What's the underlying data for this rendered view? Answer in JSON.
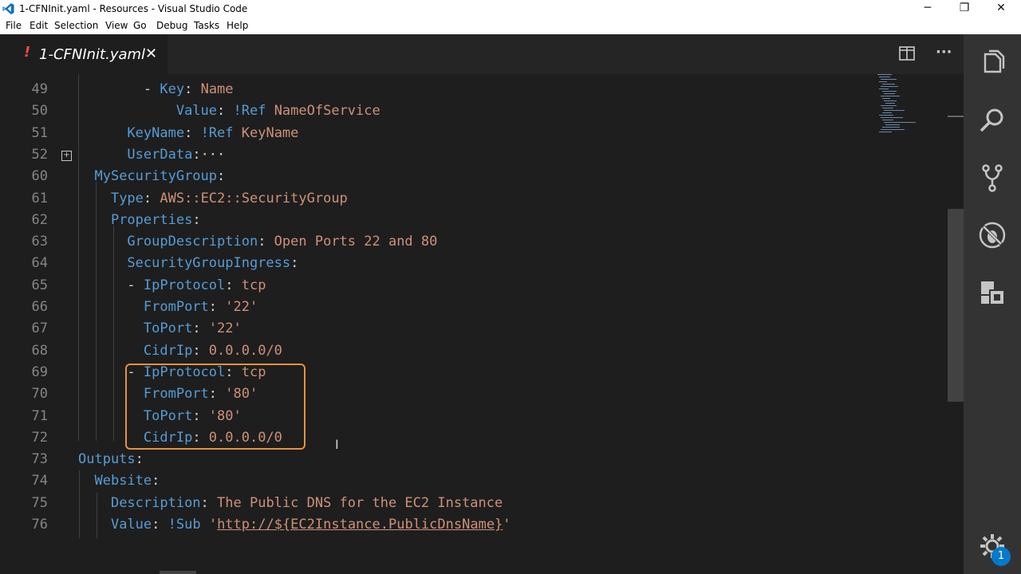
{
  "window": {
    "title": "1-CFNInit.yaml - Resources - Visual Studio Code",
    "controls": {
      "minimize": "─",
      "maximize": "❐",
      "close": "✕"
    }
  },
  "menu": [
    "File",
    "Edit",
    "Selection",
    "View",
    "Go",
    "Debug",
    "Tasks",
    "Help"
  ],
  "tab": {
    "modified_marker": "!",
    "name": "1-CFNInit.yaml",
    "close": "✕"
  },
  "editor_actions": {
    "more": "···"
  },
  "lines": [
    {
      "num": "49",
      "indent": "    ",
      "segs": [
        {
          "t": "- ",
          "c": "p"
        },
        {
          "t": "Key",
          "c": "k"
        },
        {
          "t": ": ",
          "c": "p"
        },
        {
          "t": "Name",
          "c": "s"
        }
      ]
    },
    {
      "num": "50",
      "indent": "      ",
      "segs": [
        {
          "t": "Value",
          "c": "k"
        },
        {
          "t": ": ",
          "c": "p"
        },
        {
          "t": "!Ref ",
          "c": "k"
        },
        {
          "t": "NameOfService",
          "c": "s"
        }
      ]
    },
    {
      "num": "51",
      "indent": "   ",
      "segs": [
        {
          "t": "KeyName",
          "c": "k"
        },
        {
          "t": ": ",
          "c": "p"
        },
        {
          "t": "!Ref ",
          "c": "k"
        },
        {
          "t": "KeyName",
          "c": "s"
        }
      ]
    },
    {
      "num": "52",
      "indent": "   ",
      "segs": [
        {
          "t": "UserData",
          "c": "k"
        },
        {
          "t": ":",
          "c": "p"
        },
        {
          "t": "···",
          "c": "p"
        }
      ]
    },
    {
      "num": "60",
      "indent": " ",
      "segs": [
        {
          "t": "MySecurityGroup",
          "c": "k"
        },
        {
          "t": ":",
          "c": "p"
        }
      ]
    },
    {
      "num": "61",
      "indent": "  ",
      "segs": [
        {
          "t": "Type",
          "c": "k"
        },
        {
          "t": ": ",
          "c": "p"
        },
        {
          "t": "AWS::EC2::SecurityGroup",
          "c": "s"
        }
      ]
    },
    {
      "num": "62",
      "indent": "  ",
      "segs": [
        {
          "t": "Properties",
          "c": "k"
        },
        {
          "t": ":",
          "c": "p"
        }
      ]
    },
    {
      "num": "63",
      "indent": "   ",
      "segs": [
        {
          "t": "GroupDescription",
          "c": "k"
        },
        {
          "t": ": ",
          "c": "p"
        },
        {
          "t": "Open Ports 22 and 80",
          "c": "s"
        }
      ]
    },
    {
      "num": "64",
      "indent": "   ",
      "segs": [
        {
          "t": "SecurityGroupIngress",
          "c": "k"
        },
        {
          "t": ":",
          "c": "p"
        }
      ]
    },
    {
      "num": "65",
      "indent": "   ",
      "segs": [
        {
          "t": "- ",
          "c": "p"
        },
        {
          "t": "IpProtocol",
          "c": "k"
        },
        {
          "t": ": ",
          "c": "p"
        },
        {
          "t": "tcp",
          "c": "s"
        }
      ]
    },
    {
      "num": "66",
      "indent": "    ",
      "segs": [
        {
          "t": "FromPort",
          "c": "k"
        },
        {
          "t": ": ",
          "c": "p"
        },
        {
          "t": "'22'",
          "c": "s"
        }
      ]
    },
    {
      "num": "67",
      "indent": "    ",
      "segs": [
        {
          "t": "ToPort",
          "c": "k"
        },
        {
          "t": ": ",
          "c": "p"
        },
        {
          "t": "'22'",
          "c": "s"
        }
      ]
    },
    {
      "num": "68",
      "indent": "    ",
      "segs": [
        {
          "t": "CidrIp",
          "c": "k"
        },
        {
          "t": ": ",
          "c": "p"
        },
        {
          "t": "0.0.0.0/0",
          "c": "s"
        }
      ]
    },
    {
      "num": "69",
      "indent": "   ",
      "segs": [
        {
          "t": "- ",
          "c": "p"
        },
        {
          "t": "IpProtocol",
          "c": "k"
        },
        {
          "t": ": ",
          "c": "p"
        },
        {
          "t": "tcp",
          "c": "s"
        }
      ]
    },
    {
      "num": "70",
      "indent": "    ",
      "segs": [
        {
          "t": "FromPort",
          "c": "k"
        },
        {
          "t": ": ",
          "c": "p"
        },
        {
          "t": "'80'",
          "c": "s"
        }
      ]
    },
    {
      "num": "71",
      "indent": "    ",
      "segs": [
        {
          "t": "ToPort",
          "c": "k"
        },
        {
          "t": ": ",
          "c": "p"
        },
        {
          "t": "'80'",
          "c": "s"
        }
      ]
    },
    {
      "num": "72",
      "indent": "    ",
      "segs": [
        {
          "t": "CidrIp",
          "c": "k"
        },
        {
          "t": ": ",
          "c": "p"
        },
        {
          "t": "0.0.0.0/0",
          "c": "s"
        }
      ]
    },
    {
      "num": "73",
      "indent": "",
      "segs": [
        {
          "t": "Outputs",
          "c": "k"
        },
        {
          "t": ":",
          "c": "p"
        }
      ]
    },
    {
      "num": "74",
      "indent": " ",
      "segs": [
        {
          "t": "Website",
          "c": "k"
        },
        {
          "t": ":",
          "c": "p"
        }
      ]
    },
    {
      "num": "75",
      "indent": "  ",
      "segs": [
        {
          "t": "Description",
          "c": "k"
        },
        {
          "t": ": ",
          "c": "p"
        },
        {
          "t": "The Public DNS for the EC2 Instance",
          "c": "s"
        }
      ]
    },
    {
      "num": "76",
      "indent": "  ",
      "segs": [
        {
          "t": "Value",
          "c": "k"
        },
        {
          "t": ": ",
          "c": "p"
        },
        {
          "t": "!Sub ",
          "c": "k"
        },
        {
          "t": "'",
          "c": "s"
        },
        {
          "t": "http://${EC2Instance.PublicDnsName}",
          "c": "c"
        },
        {
          "t": "'",
          "c": "s"
        }
      ]
    }
  ],
  "activity_bar": {
    "icons": [
      "explorer-icon",
      "search-icon",
      "source-control-icon",
      "debug-icon",
      "extensions-icon",
      "settings-gear-icon"
    ],
    "settings_badge": "1"
  },
  "colors": {
    "keyword": "#569cd6",
    "string": "#ce9178",
    "plain": "#d4d4d4",
    "highlight_box": "#e8923c",
    "badge": "#007acc"
  }
}
